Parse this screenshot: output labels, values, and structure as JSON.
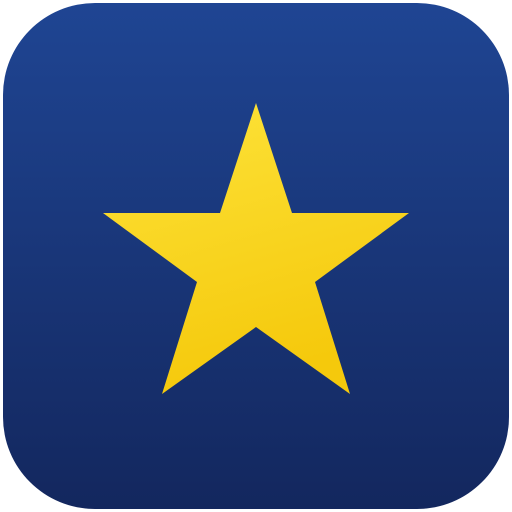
{
  "icon": {
    "name": "star-icon",
    "colors": {
      "background_top": "#1f4593",
      "background_bottom": "#13275e",
      "star_fill": "#f5c90c",
      "star_highlight": "#fde33a",
      "page_background": "#ffffff"
    }
  }
}
